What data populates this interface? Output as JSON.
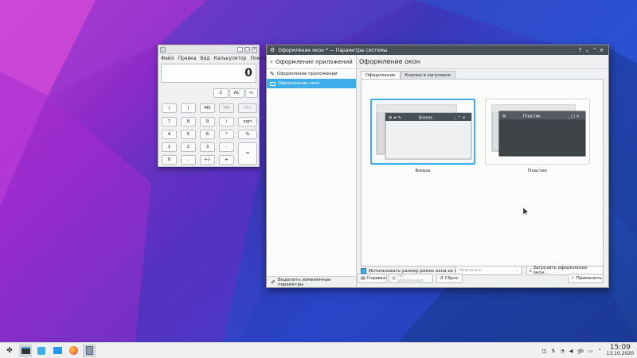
{
  "calculator": {
    "menu": [
      "Файл",
      "Правка",
      "Вид",
      "Калькулятор",
      "Помощь"
    ],
    "display": "0",
    "buttons": {
      "c": "C",
      "ac": "AC",
      "back": "<-",
      "lpar": "(",
      "rpar": ")",
      "ms": "MS",
      "mr": "MR",
      "mplus": "M+",
      "n7": "7",
      "n8": "8",
      "n9": "9",
      "div": "/",
      "sqrt": "sqrt",
      "n4": "4",
      "n5": "5",
      "n6": "6",
      "mul": "*",
      "pct": "%",
      "n1": "1",
      "n2": "2",
      "n3": "3",
      "minus": "-",
      "eq": "=",
      "n0": "0",
      "dot": ".",
      "pm": "+/-",
      "plus": "+"
    }
  },
  "settings": {
    "window_title": "Оформление окон * — Параметры системы",
    "side_header": "Оформление приложений",
    "side_items": [
      "Оформление приложений",
      "Оформление окон"
    ],
    "highlight_label": "Выделить изменённые параметры",
    "page_title": "Оформление окон",
    "tabs": [
      "Оформление",
      "Кнопки в заголовке"
    ],
    "themes": [
      {
        "label": "Breeze",
        "preview_title": "Breeze"
      },
      {
        "label": "Пластик",
        "preview_title": "Пластик"
      }
    ],
    "border_checkbox_label": "Использовать размер рамок окна из оф",
    "border_select": "Нормальн",
    "download_label": "Загрузить оформления окон...",
    "buttons": {
      "help": "Справка",
      "defaults": "По умолчанию",
      "reset": "Сброс",
      "apply": "Применить"
    }
  },
  "taskbar": {
    "clock_time": "15:09",
    "clock_date": "13.10.2020",
    "keyboard_layout": "gb"
  },
  "colors": {
    "accent": "#3daee9",
    "titlebar": "#475057"
  }
}
